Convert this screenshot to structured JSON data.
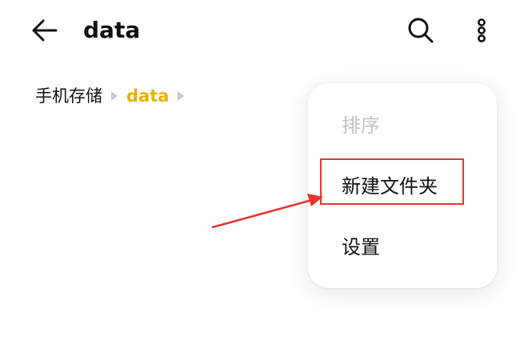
{
  "appbar": {
    "title": "data",
    "back_icon": "arrow-left-icon",
    "search_icon": "search-icon",
    "more_icon": "more-vertical-icon"
  },
  "breadcrumb": {
    "items": [
      "手机存储",
      "data"
    ],
    "separator_icon": "triangle-right-icon"
  },
  "menu": {
    "items": [
      {
        "label": "排序",
        "enabled": false
      },
      {
        "label": "新建文件夹",
        "enabled": true
      },
      {
        "label": "设置",
        "enabled": true
      }
    ]
  },
  "colors": {
    "accent": "#e8b300",
    "annotation": "#e8322f",
    "text": "#111111",
    "disabled_text": "#c4c4c4"
  }
}
